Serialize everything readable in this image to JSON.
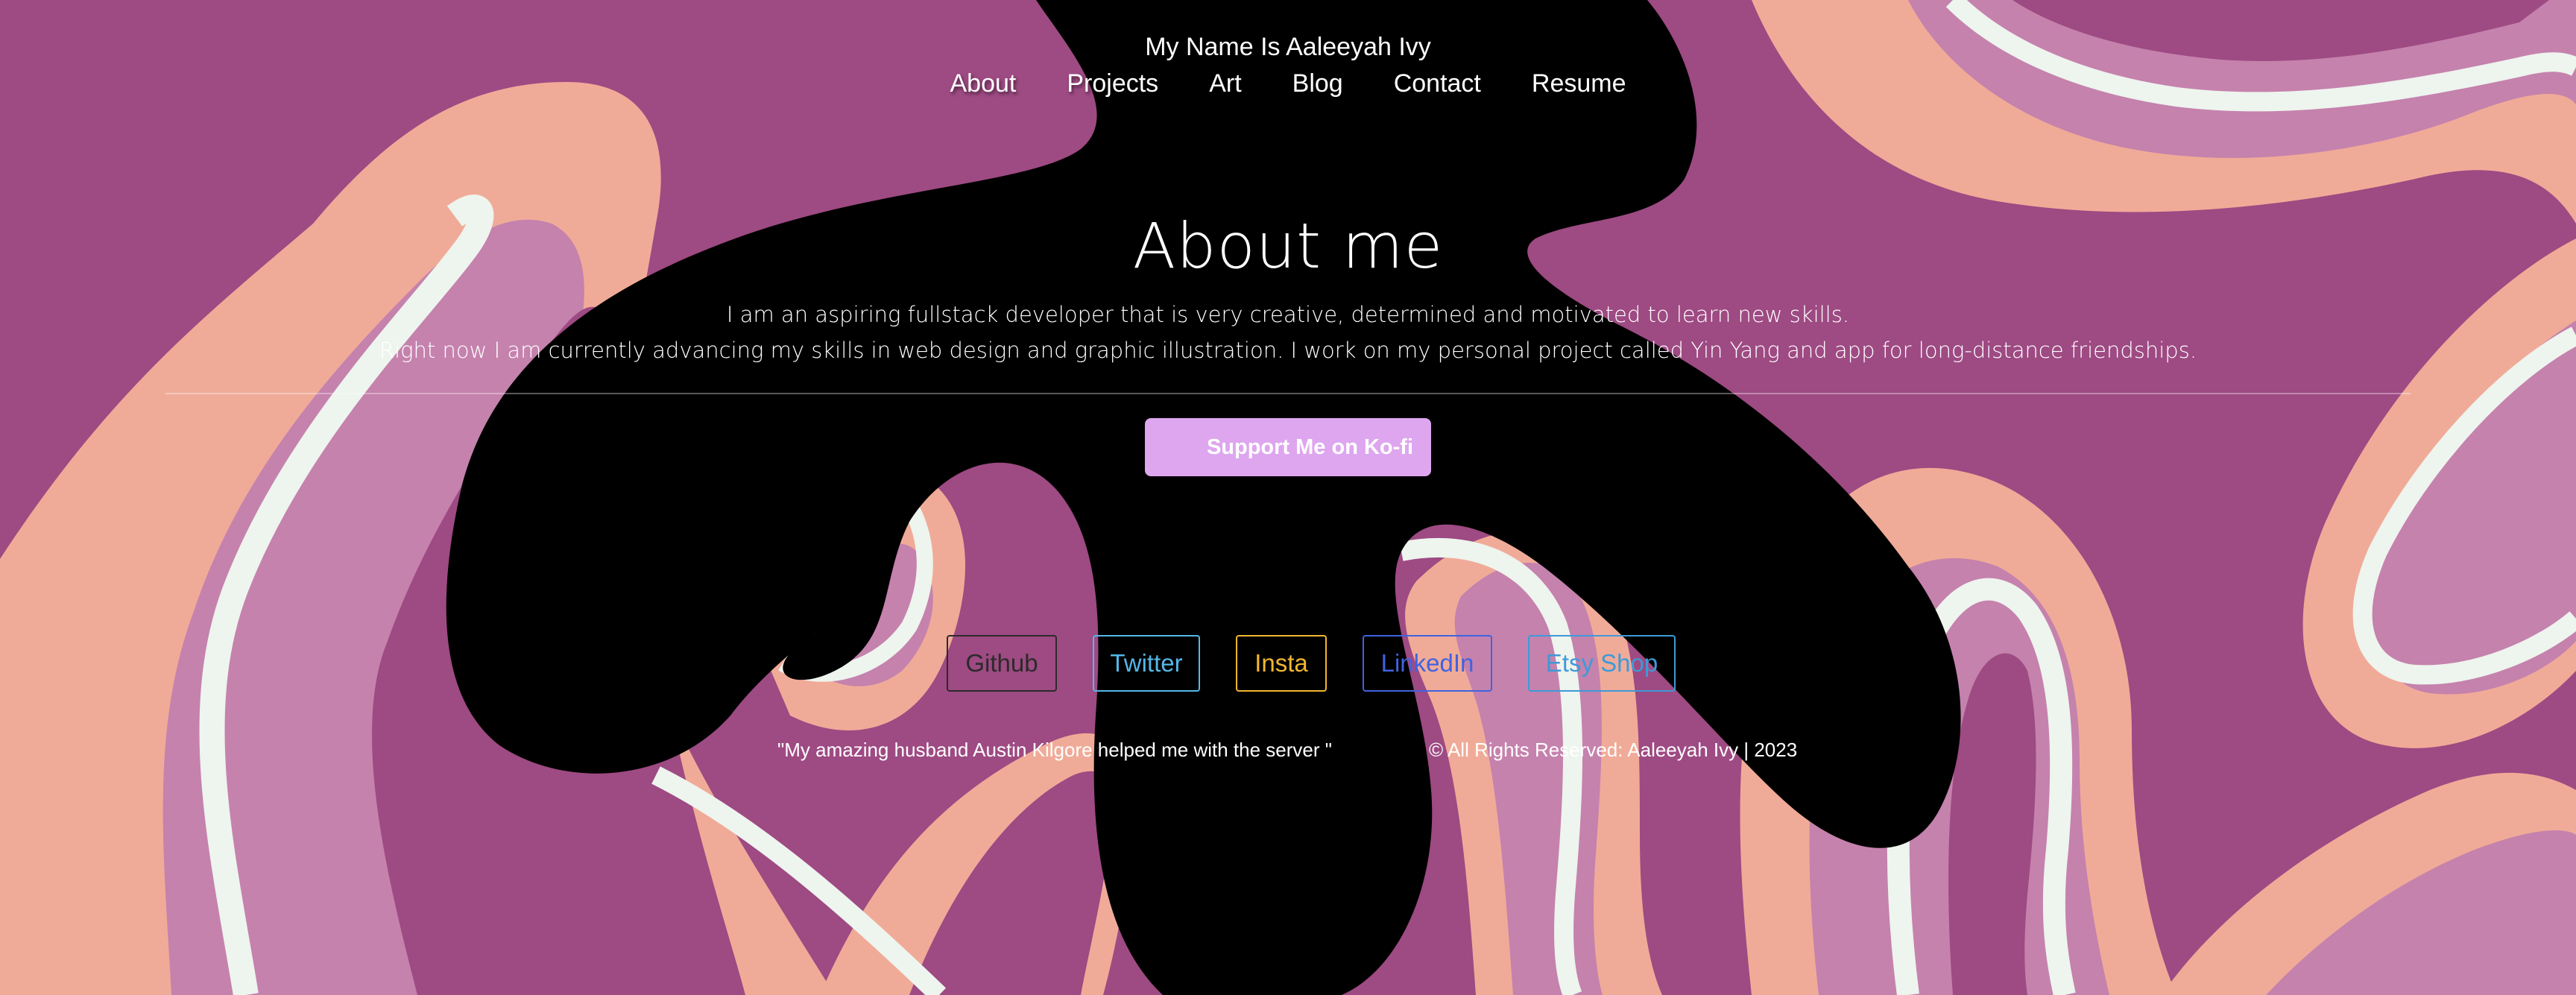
{
  "header": {
    "site_title": "My Name Is Aaleeyah Ivy",
    "nav": [
      {
        "label": "About"
      },
      {
        "label": "Projects"
      },
      {
        "label": "Art"
      },
      {
        "label": "Blog"
      },
      {
        "label": "Contact"
      },
      {
        "label": "Resume"
      }
    ]
  },
  "about": {
    "title": "About me",
    "line1": "I am an aspiring fullstack developer that is very creative, determined and motivated to learn new skills.",
    "line2": "Right now I am currently advancing my skills in web design and graphic illustration. I work on my personal project called Yin Yang and app for long-distance friendships."
  },
  "kofi": {
    "label": "Support Me on Ko-fi",
    "color": "#dea6ef"
  },
  "socials": [
    {
      "label": "Github",
      "color": "#2b2b2b"
    },
    {
      "label": "Twitter",
      "color": "#55b7e8"
    },
    {
      "label": "Insta",
      "color": "#f2b630"
    },
    {
      "label": "LinkedIn",
      "color": "#3f63e0"
    },
    {
      "label": "Etsy Shop",
      "color": "#3d9ad8"
    }
  ],
  "footer": {
    "credit": "\"My amazing husband Austin Kilgore helped me with the server \"",
    "copyright": "© All Rights Reserved: Aaleeyah Ivy | 2023"
  },
  "colors": {
    "background": "#9e4a83",
    "light_pink": "#c582ad",
    "peach": "#f0ab98",
    "white_stripe": "#eef4ee",
    "black_blob": "#000000"
  }
}
